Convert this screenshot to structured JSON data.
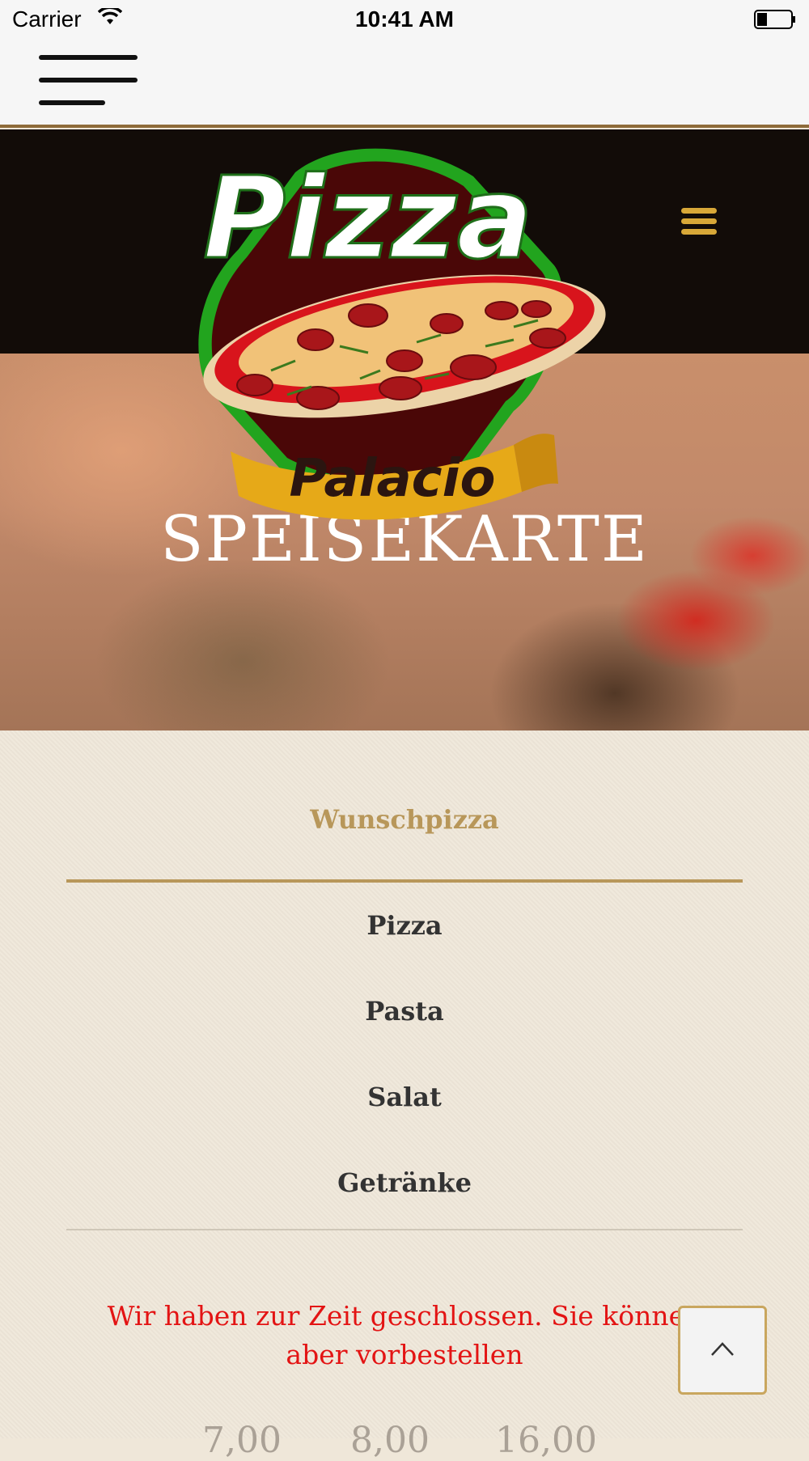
{
  "status_bar": {
    "carrier": "Carrier",
    "time": "10:41 AM"
  },
  "hero": {
    "title": "SPEISEKARTE"
  },
  "logo": {
    "word_top": "Pizza",
    "word_ribbon": "Palacio"
  },
  "menu": {
    "items": [
      {
        "label": "Wunschpizza",
        "active": true
      },
      {
        "label": "Pizza",
        "active": false
      },
      {
        "label": "Pasta",
        "active": false
      },
      {
        "label": "Salat",
        "active": false
      },
      {
        "label": "Getränke",
        "active": false
      }
    ]
  },
  "notice": "Wir haben zur Zeit geschlossen. Sie können aber vorbestellen",
  "prices": [
    "7,00",
    "8,00",
    "16,00"
  ],
  "colors": {
    "accent": "#b8975a",
    "notice": "#e31414",
    "header_bg": "#120c08",
    "menu_icon": "#d8a838"
  },
  "icons": {
    "app_menu": "hamburger-icon",
    "site_menu": "menu-icon",
    "scroll_top": "chevron-up-icon"
  }
}
